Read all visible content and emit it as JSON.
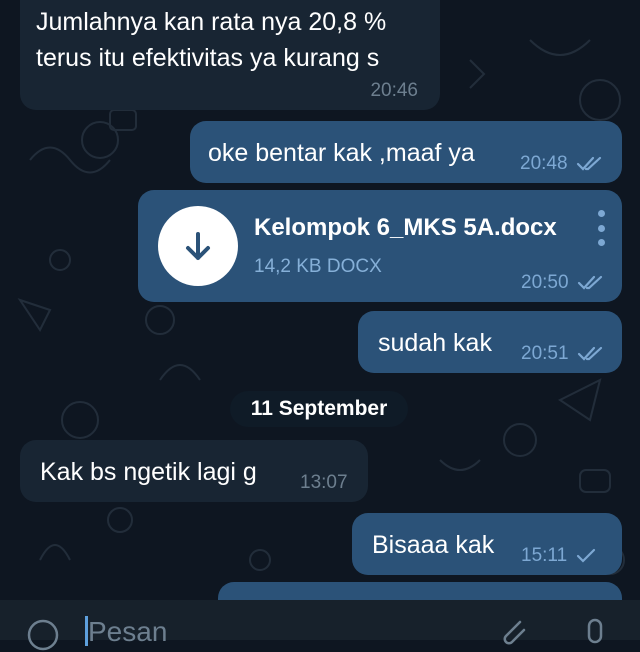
{
  "messages": [
    {
      "id": "m1",
      "direction": "incoming",
      "lines": [
        "Jumlahnya kan rata nya 20,8 %",
        "terus itu efektivitas ya kurang s"
      ],
      "time": "20:46"
    },
    {
      "id": "m2",
      "direction": "outgoing",
      "text": "oke bentar kak ,maaf ya",
      "time": "20:48",
      "status": "read"
    },
    {
      "id": "m3",
      "direction": "outgoing",
      "type": "file",
      "file_name": "Kelompok 6_MKS 5A.docx",
      "file_info": "14,2 KB DOCX",
      "time": "20:50",
      "status": "read"
    },
    {
      "id": "m4",
      "direction": "outgoing",
      "text": "sudah kak",
      "time": "20:51",
      "status": "read"
    },
    {
      "id": "m5",
      "direction": "incoming",
      "text": "Kak bs ngetik lagi g",
      "time": "13:07"
    },
    {
      "id": "m6",
      "direction": "outgoing",
      "text": "Bisaaa kak",
      "time": "15:11",
      "status": "sent"
    }
  ],
  "date_separator": "11 September",
  "input": {
    "placeholder": "Pesan"
  },
  "icons": {
    "download": "download-arrow-icon",
    "menu": "more-vertical-icon",
    "read": "double-check-icon",
    "sent": "single-check-icon",
    "emoji": "emoji-icon",
    "attach": "paperclip-icon",
    "mic": "microphone-icon"
  },
  "colors": {
    "background": "#0e1621",
    "incoming": "#182533",
    "outgoing": "#2b5278",
    "accent": "#5ea0dd"
  }
}
